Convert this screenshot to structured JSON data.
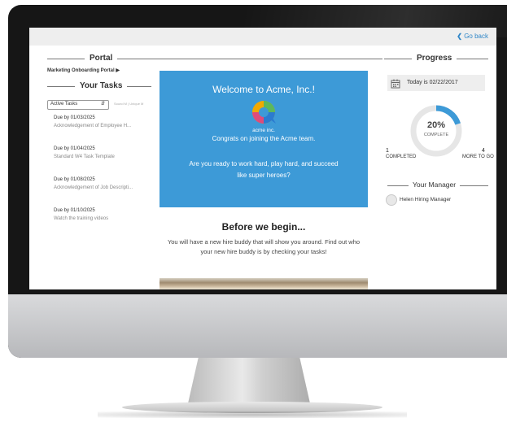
{
  "top_nav": {
    "go_back": "Go back"
  },
  "left": {
    "portal_title": "Portal",
    "breadcrumb": "Marketing Onboarding Portal",
    "tasks_title": "Your Tasks",
    "filter": {
      "selected": "Active Tasks",
      "note": "Sound M | Unique M"
    },
    "tasks": [
      {
        "due": "Due by 01/03/2025",
        "name": "Acknowledgement of Employee H..."
      },
      {
        "due": "Due by 01/04/2025",
        "name": "Standard W4 Task Template"
      },
      {
        "due": "Due by 01/08/2025",
        "name": "Acknowledgement of Job Descripti..."
      },
      {
        "due": "Due by 01/10/2025",
        "name": "Watch the training videos"
      }
    ]
  },
  "main": {
    "welcome_title": "Welcome to Acme, Inc.!",
    "brand_name": "acme inc.",
    "congrats": "Congrats on joining the Acme team.",
    "ready_line1": "Are you ready to work hard, play hard, and succeed",
    "ready_line2": "like super heroes?",
    "before_title": "Before we begin...",
    "before_line1": "You will have a new hire buddy that will show you around. Find out who",
    "before_line2": "your new hire buddy is by checking your tasks!"
  },
  "right": {
    "progress_title": "Progress",
    "today": "Today is 02/22/2017",
    "progress_fraction": 0.2,
    "percent_label": "20%",
    "complete_label": "COMPLETE",
    "completed_count": "1",
    "completed_label": "COMPLETED",
    "remaining_count": "4",
    "remaining_label": "MORE TO GO",
    "manager_title": "Your Manager",
    "manager_name": "Helen Hiring Manager"
  },
  "colors": {
    "accent_blue": "#3d9ad7",
    "link_blue": "#2f86c8",
    "progress_track": "#e6e6e6"
  },
  "icons": [
    "chevron-left-icon",
    "caret-right-icon",
    "chevron-updown-icon",
    "calendar-icon",
    "acme-logo",
    "avatar-icon"
  ]
}
